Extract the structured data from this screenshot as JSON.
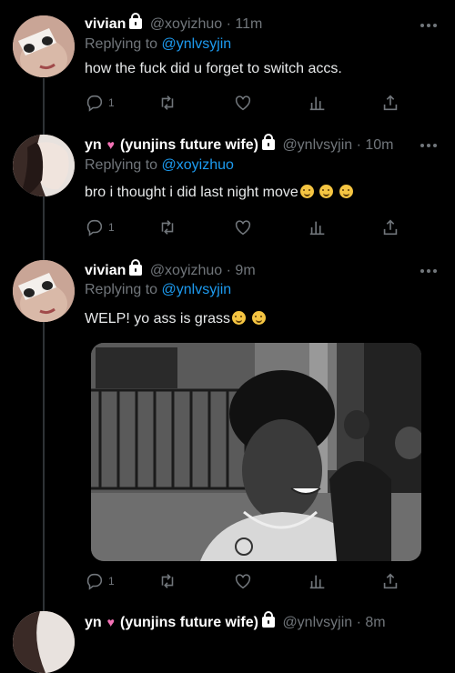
{
  "tweets": [
    {
      "name": "vivian",
      "handle": "@xoyizhuo",
      "time": "· 11m",
      "replying_label": "Replying to",
      "replying_handle": "@ynlvsyjin",
      "text": "how the fuck did u forget to switch accs.",
      "reply_count": "1"
    },
    {
      "name": "yn",
      "name_suffix": "(yunjins future wife)",
      "handle": "@ynlvsyjin",
      "time": "· 10m",
      "replying_label": "Replying to",
      "replying_handle": "@xoyizhuo",
      "text": "bro i thought i did last night move",
      "reply_count": "1"
    },
    {
      "name": "vivian",
      "handle": "@xoyizhuo",
      "time": "· 9m",
      "replying_label": "Replying to",
      "replying_handle": "@ynlvsyjin",
      "text": "WELP! yo ass is grass",
      "reply_count": "1"
    },
    {
      "name": "yn",
      "name_suffix": "(yunjins future wife)",
      "handle": "@ynlvsyjin",
      "time": "· 8m"
    }
  ],
  "icons": {
    "reply": "reply-icon",
    "retweet": "retweet-icon",
    "like": "heart-icon",
    "views": "views-icon",
    "share": "share-icon",
    "more": "more-icon",
    "lock": "lock-icon"
  },
  "colors": {
    "background": "#000000",
    "link": "#1d9bf0",
    "muted": "#71767b",
    "text": "#e7e9ea"
  }
}
